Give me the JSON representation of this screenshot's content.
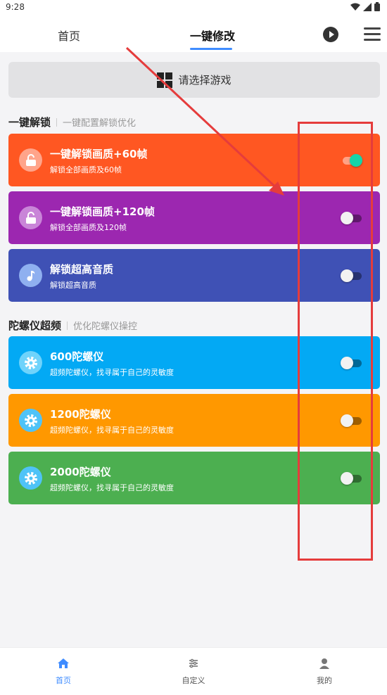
{
  "status_bar": {
    "time": "9:28"
  },
  "top_nav": {
    "tabs": [
      {
        "label": "首页"
      },
      {
        "label": "一键修改"
      }
    ]
  },
  "game_select": {
    "label": "请选择游戏"
  },
  "sections": [
    {
      "title": "一键解锁",
      "subtitle": "一键配置解锁优化",
      "cards": [
        {
          "title": "一键解锁画质+60帧",
          "desc": "解锁全部画质及60帧",
          "icon": "unlock-icon",
          "color": "#ff5722",
          "icon_bg": "#ffa48a",
          "enabled": true
        },
        {
          "title": "一键解锁画质+120帧",
          "desc": "解锁全部画质及120帧",
          "icon": "unlock-icon",
          "color": "#9c27b0",
          "icon_bg": "#c985d8",
          "enabled": false
        },
        {
          "title": "解锁超高音质",
          "desc": "解锁超高音质",
          "icon": "music-note-icon",
          "color": "#3f51b5",
          "icon_bg": "#8fb0f0",
          "enabled": false
        }
      ]
    },
    {
      "title": "陀螺仪超频",
      "subtitle": "优化陀螺仪操控",
      "cards": [
        {
          "title": "600陀螺仪",
          "desc": "超频陀螺仪，找寻属于自己的灵敏度",
          "icon": "gear-icon",
          "color": "#03a9f4",
          "icon_bg": "#6fd3fb",
          "enabled": false
        },
        {
          "title": "1200陀螺仪",
          "desc": "超频陀螺仪，找寻属于自己的灵敏度",
          "icon": "gear-icon",
          "color": "#ff9800",
          "icon_bg": "#4fc3f7",
          "enabled": false
        },
        {
          "title": "2000陀螺仪",
          "desc": "超频陀螺仪，找寻属于自己的灵敏度",
          "icon": "gear-icon",
          "color": "#4caf50",
          "icon_bg": "#4fc3f7",
          "enabled": false
        }
      ]
    }
  ],
  "bottom_nav": {
    "items": [
      {
        "label": "首页",
        "icon": "home-icon",
        "active": true
      },
      {
        "label": "自定义",
        "icon": "sliders-icon",
        "active": false
      },
      {
        "label": "我的",
        "icon": "person-icon",
        "active": false
      }
    ]
  },
  "colors": {
    "accent": "#3f8cff",
    "toggle_on": "#16d4a8",
    "annotation": "#e53c3c"
  }
}
